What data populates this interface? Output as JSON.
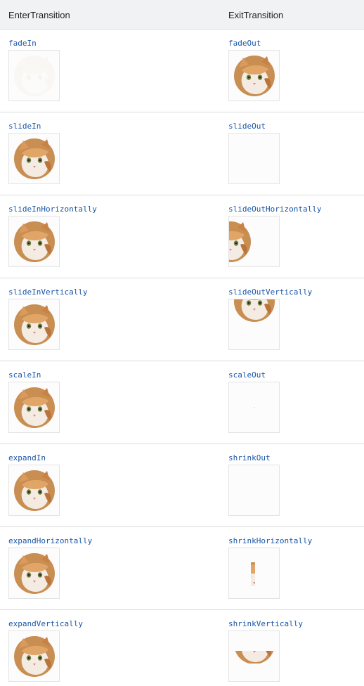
{
  "table": {
    "headers": {
      "enter": "EnterTransition",
      "exit": "ExitTransition"
    },
    "rows": [
      {
        "enter": "fadeIn",
        "exit": "fadeOut"
      },
      {
        "enter": "slideIn",
        "exit": "slideOut"
      },
      {
        "enter": "slideInHorizontally",
        "exit": "slideOutHorizontally"
      },
      {
        "enter": "slideInVertically",
        "exit": "slideOutVertically"
      },
      {
        "enter": "scaleIn",
        "exit": "scaleOut"
      },
      {
        "enter": "expandIn",
        "exit": "shrinkOut"
      },
      {
        "enter": "expandHorizontally",
        "exit": "shrinkHorizontally"
      },
      {
        "enter": "expandVertically",
        "exit": "shrinkVertically"
      }
    ]
  },
  "colors": {
    "header_bg": "#f0f2f4",
    "code_text": "#1a56a8",
    "divider": "#dadce0",
    "frame_border": "#e3e3e3"
  },
  "icons": {
    "preview": "cat-icon"
  }
}
